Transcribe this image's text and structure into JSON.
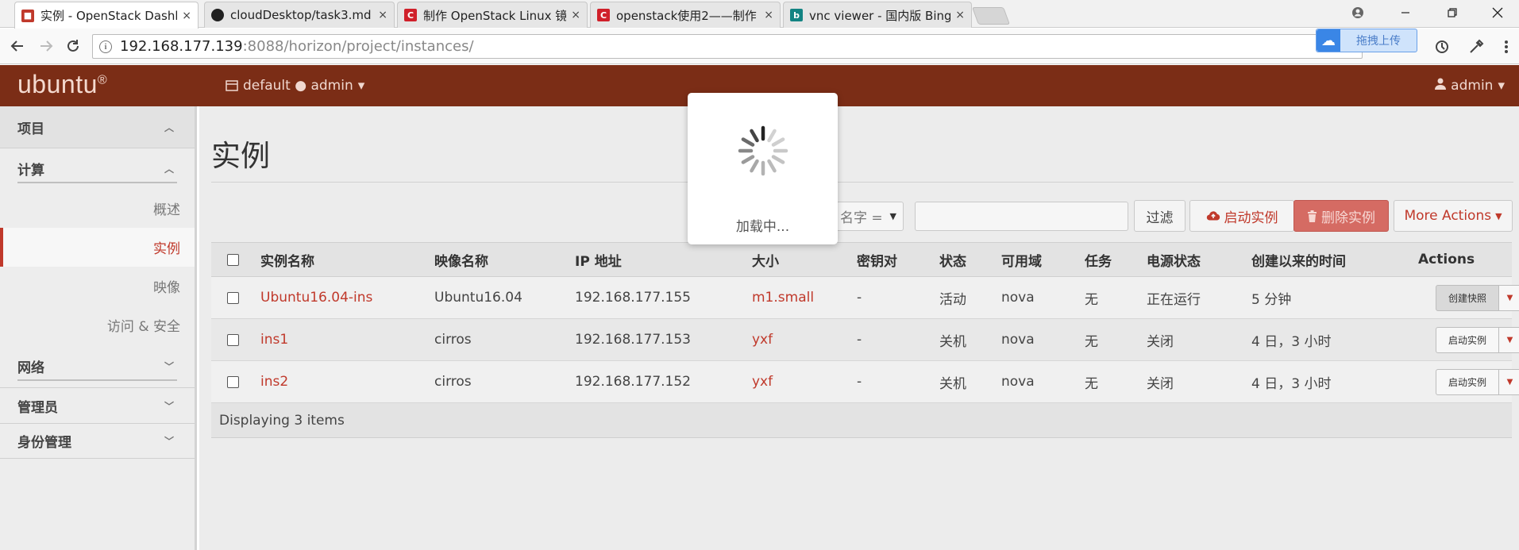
{
  "browser": {
    "tabs": [
      {
        "title": "实例 - OpenStack Dashb",
        "favicon_color": "#c0392b",
        "favicon_glyph": "■"
      },
      {
        "title": "cloudDesktop/task3.md",
        "favicon_color": "#222222",
        "favicon_glyph": "●"
      },
      {
        "title": "制作 OpenStack Linux 镜",
        "favicon_color": "#d0202a",
        "favicon_glyph": "C"
      },
      {
        "title": "openstack使用2——制作",
        "favicon_color": "#d0202a",
        "favicon_glyph": "C"
      },
      {
        "title": "vnc viewer - 国内版 Bing",
        "favicon_color": "#138483",
        "favicon_glyph": "b"
      }
    ],
    "tab_close_glyph": "×",
    "url_host": "192.168.177.139",
    "url_rest": ":8088/horizon/project/instances/",
    "upload_label": "拖拽上传",
    "window_controls": [
      "user-icon",
      "minimize-icon",
      "restore-icon",
      "close-icon"
    ]
  },
  "header": {
    "logo": "ubuntu",
    "logo_mark": "®",
    "project": "default ● admin",
    "user": "admin"
  },
  "sidebar": {
    "groups": [
      {
        "label": "项目",
        "expanded": true
      },
      {
        "label": "计算",
        "expanded": true
      },
      {
        "label": "网络",
        "expanded": false
      },
      {
        "label": "管理员",
        "expanded": false
      },
      {
        "label": "身份管理",
        "expanded": false
      }
    ],
    "items": [
      {
        "label": "概述"
      },
      {
        "label": "实例",
        "active": true
      },
      {
        "label": "映像"
      },
      {
        "label": "访问 & 安全"
      }
    ]
  },
  "main": {
    "title": "实例",
    "filter_select": "名字 =",
    "buttons": {
      "filter": "过滤",
      "launch": "启动实例",
      "delete": "删除实例",
      "more": "More Actions"
    },
    "columns": [
      "实例名称",
      "映像名称",
      "IP 地址",
      "大小",
      "密钥对",
      "状态",
      "可用域",
      "任务",
      "电源状态",
      "创建以来的时间",
      "Actions"
    ],
    "rows": [
      {
        "name": "Ubuntu16.04-ins",
        "image": "Ubuntu16.04",
        "ip": "192.168.177.155",
        "size": "m1.small",
        "keypair": "-",
        "status": "活动",
        "zone": "nova",
        "task": "无",
        "power": "正在运行",
        "age": "5 分钟",
        "action": "创建快照"
      },
      {
        "name": "ins1",
        "image": "cirros",
        "ip": "192.168.177.153",
        "size": "yxf",
        "keypair": "-",
        "status": "关机",
        "zone": "nova",
        "task": "无",
        "power": "关闭",
        "age": "4 日，3 小时",
        "action": "启动实例"
      },
      {
        "name": "ins2",
        "image": "cirros",
        "ip": "192.168.177.152",
        "size": "yxf",
        "keypair": "-",
        "status": "关机",
        "zone": "nova",
        "task": "无",
        "power": "关闭",
        "age": "4 日，3 小时",
        "action": "启动实例"
      }
    ],
    "footer": "Displaying 3 items"
  },
  "loading": {
    "text": "加载中..."
  },
  "colors": {
    "brand": "#7b2d16",
    "accent": "#c0392b",
    "danger_button": "#d56b63"
  }
}
